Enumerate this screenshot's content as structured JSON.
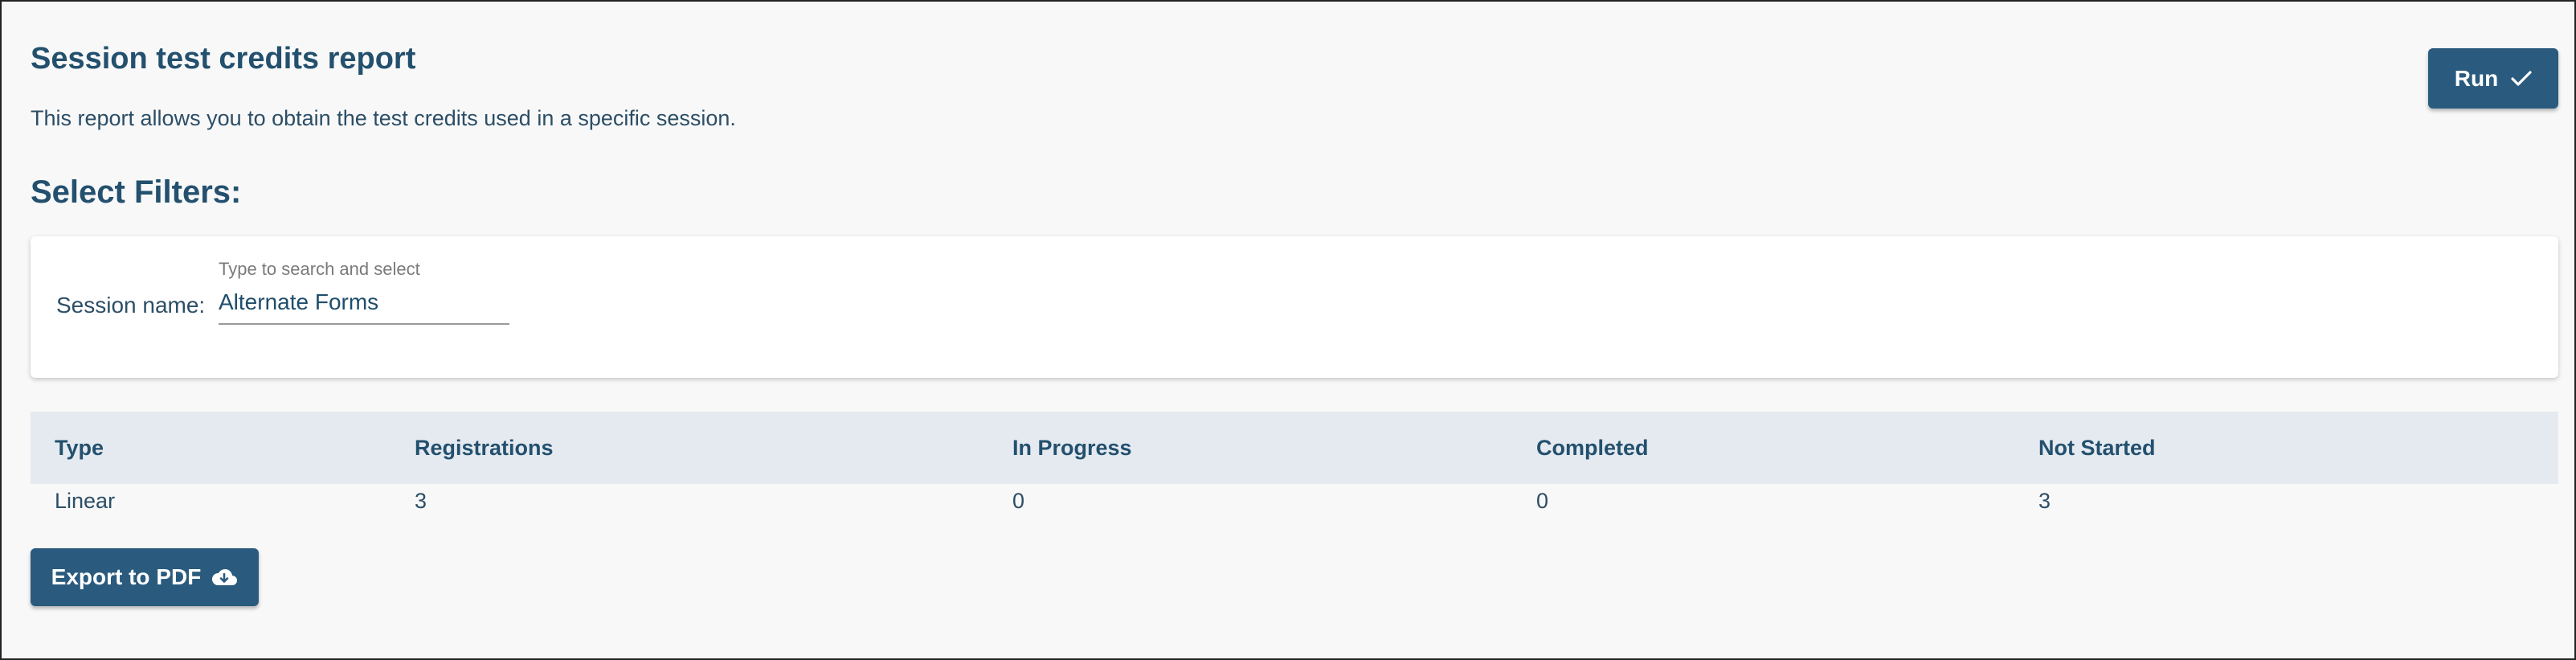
{
  "header": {
    "title": "Session test credits report",
    "description": "This report allows you to obtain the test credits used in a specific session.",
    "run_label": "Run"
  },
  "filters": {
    "heading": "Select Filters:",
    "session_label": "Session name:",
    "session_hint": "Type to search and select",
    "session_value": "Alternate Forms"
  },
  "table": {
    "headers": [
      "Type",
      "Registrations",
      "In Progress",
      "Completed",
      "Not Started"
    ],
    "rows": [
      [
        "Linear",
        "3",
        "0",
        "0",
        "3"
      ]
    ]
  },
  "export": {
    "label": "Export to PDF"
  },
  "icons": {
    "run": "check-icon",
    "export": "cloud-download-icon"
  },
  "colors": {
    "primary_button": "#2a5b7e",
    "heading_text": "#23506e",
    "table_header_bg": "#e5eaf0",
    "page_bg": "#f8f8f8"
  }
}
